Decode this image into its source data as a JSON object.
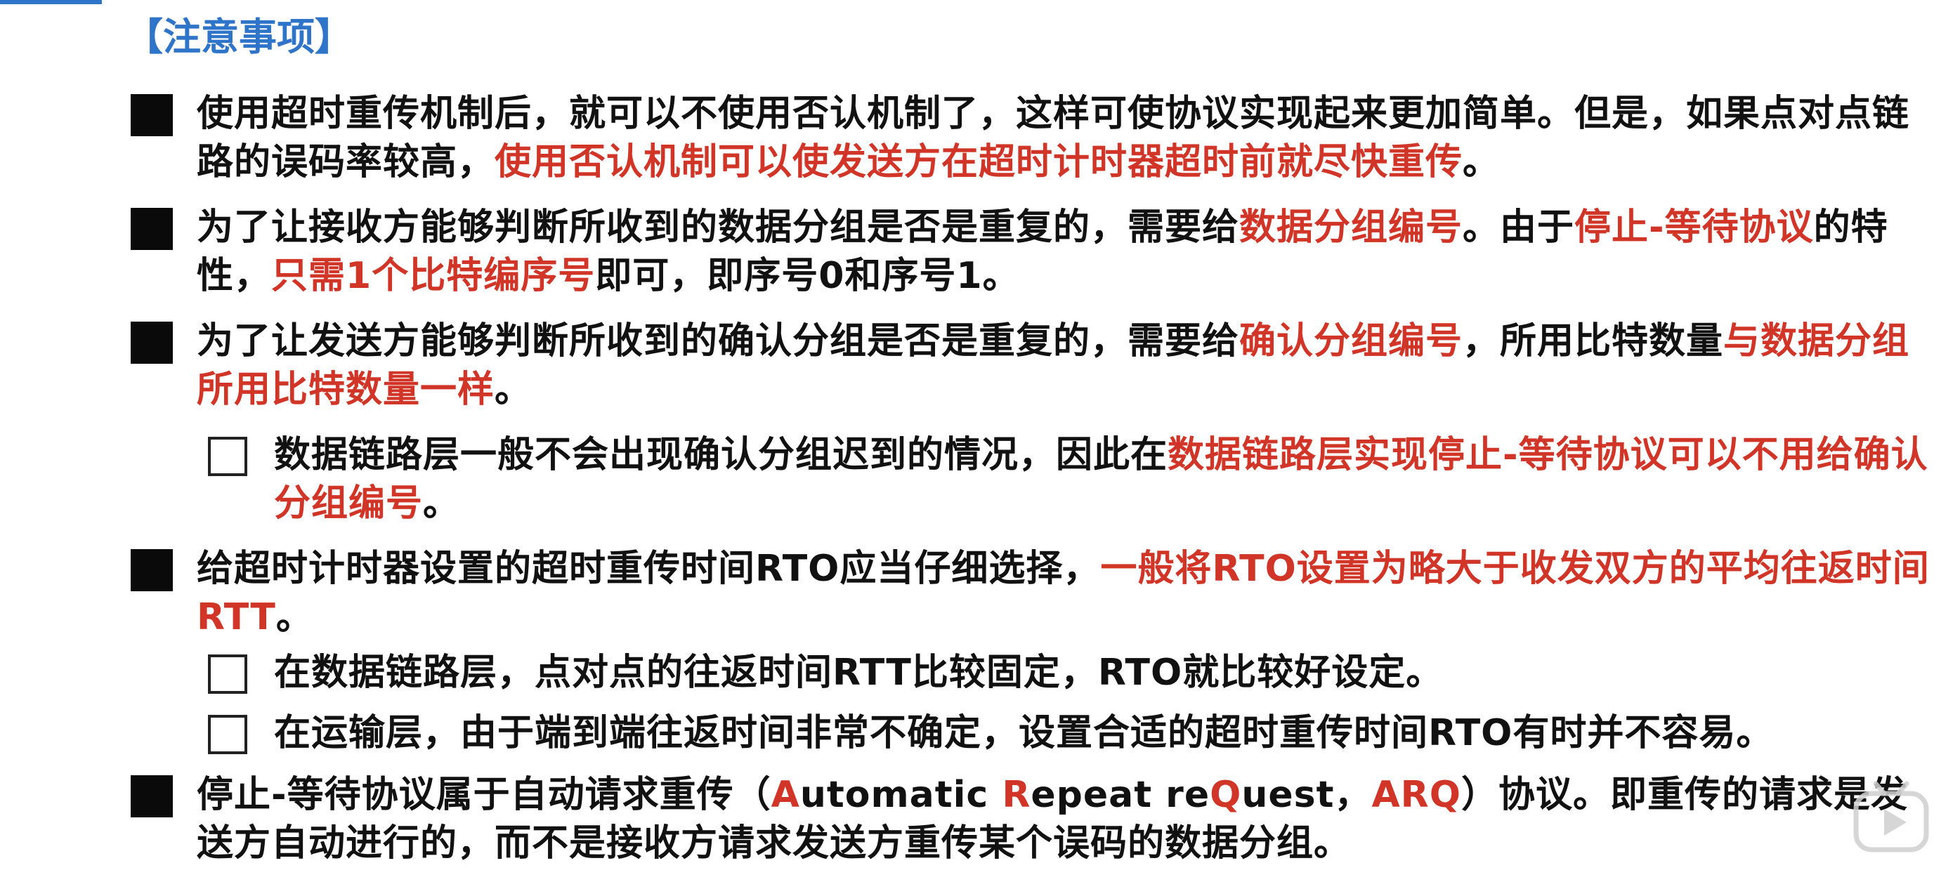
{
  "heading": "【注意事项】",
  "items": [
    {
      "segments": [
        {
          "t": "使用超时重传机制后，就可以不使用否认机制了，这样可使协议实现起来更加简单。但是，如果点对点链路的误码率较高，"
        },
        {
          "t": "使用否认机制可以使发送方在超时计时器超时前就尽快重传",
          "red": true
        },
        {
          "t": "。"
        }
      ]
    },
    {
      "segments": [
        {
          "t": "为了让接收方能够判断所收到的数据分组是否是重复的，需要给"
        },
        {
          "t": "数据分组编号",
          "red": true
        },
        {
          "t": "。由于"
        },
        {
          "t": "停止-等待协议",
          "red": true
        },
        {
          "t": "的特性，"
        },
        {
          "t": "只需1个比特编序号",
          "red": true
        },
        {
          "t": "即可，即序号0和序号1。"
        }
      ]
    },
    {
      "segments": [
        {
          "t": "为了让发送方能够判断所收到的确认分组是否是重复的，需要给"
        },
        {
          "t": "确认分组编号",
          "red": true
        },
        {
          "t": "，所用比特数量"
        },
        {
          "t": "与数据分组所用比特数量一样",
          "red": true
        },
        {
          "t": "。"
        }
      ]
    },
    {
      "segments": [
        {
          "t": "数据链路层一般不会出现确认分组迟到的情况，因此在"
        },
        {
          "t": "数据链路层实现停止-等待协议可以不用给确认分组编号",
          "red": true
        },
        {
          "t": "。"
        }
      ]
    },
    {
      "segments": [
        {
          "t": "给超时计时器设置的超时重传时间RTO应当仔细选择，"
        },
        {
          "t": "一般将RTO设置为略大于收发双方的平均往返时间RTT",
          "red": true
        },
        {
          "t": "。"
        }
      ]
    },
    {
      "segments": [
        {
          "t": "在数据链路层，点对点的往返时间RTT比较固定，RTO就比较好设定。"
        }
      ]
    },
    {
      "segments": [
        {
          "t": "在运输层，由于端到端往返时间非常不确定，设置合适的超时重传时间RTO有时并不容易。"
        }
      ]
    },
    {
      "segments": [
        {
          "t": "停止-等待协议属于自动请求重传（"
        },
        {
          "t": "A",
          "red": true
        },
        {
          "t": "utomatic "
        },
        {
          "t": "R",
          "red": true
        },
        {
          "t": "epeat re"
        },
        {
          "t": "Q",
          "red": true
        },
        {
          "t": "uest，"
        },
        {
          "t": "ARQ",
          "red": true
        },
        {
          "t": "）协议。即重传的请求是发送方自动进行的，而不是接收方请求发送方重传某个误码的数据分组。"
        }
      ]
    }
  ]
}
